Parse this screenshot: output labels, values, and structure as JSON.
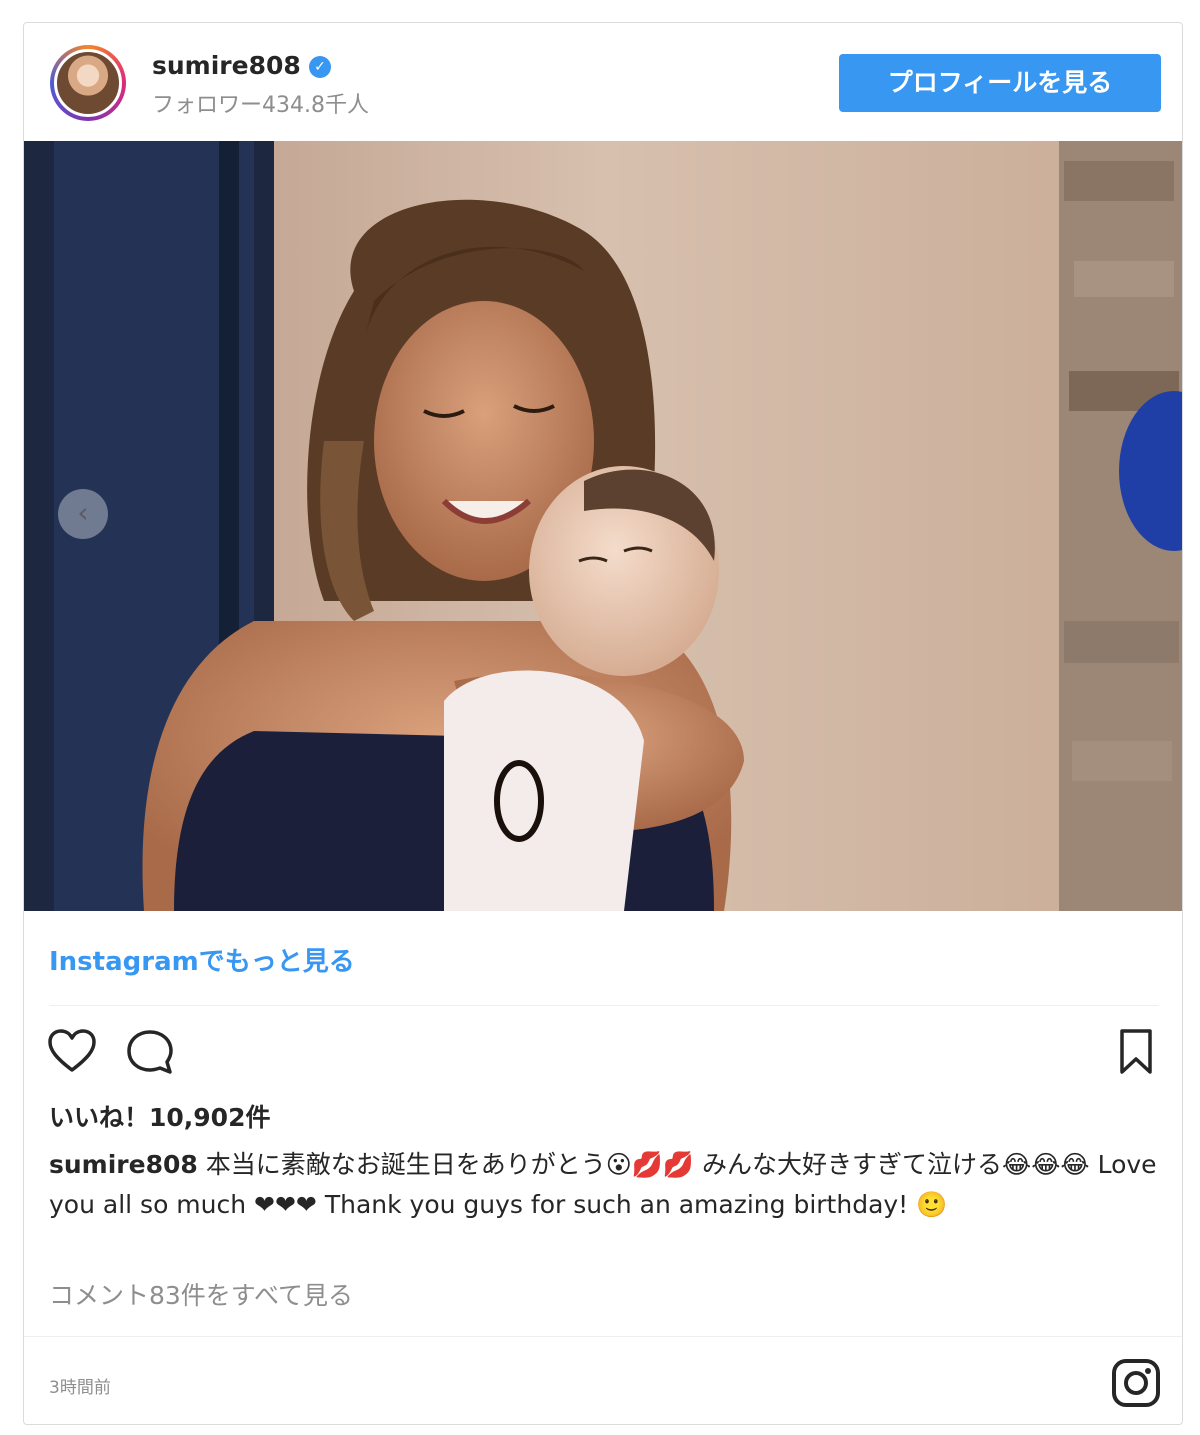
{
  "header": {
    "username": "sumire808",
    "verified_glyph": "✓",
    "followers": "フォロワー434.8千人",
    "profile_button": "プロフィールを見る"
  },
  "photo": {
    "prev_glyph": "‹"
  },
  "more_link": "Instagramでもっと見る",
  "actions": {
    "like_icon": "heart-icon",
    "comment_icon": "comment-icon",
    "save_icon": "bookmark-icon"
  },
  "likes": "いいね！10,902件",
  "caption": {
    "username": "sumire808",
    "text": " 本当に素敵なお誕生日をありがとう😮💋💋 みんな大好きすぎて泣ける😂😂😂 Love you all so much ❤❤❤ Thank you guys for such an amazing birthday! 🙂"
  },
  "comments_link": "コメント83件をすべて見る",
  "timestamp": "3時間前",
  "colors": {
    "accent": "#3897f0",
    "text": "#262626",
    "muted": "#8e8e8e",
    "border": "#dbdbdb"
  }
}
